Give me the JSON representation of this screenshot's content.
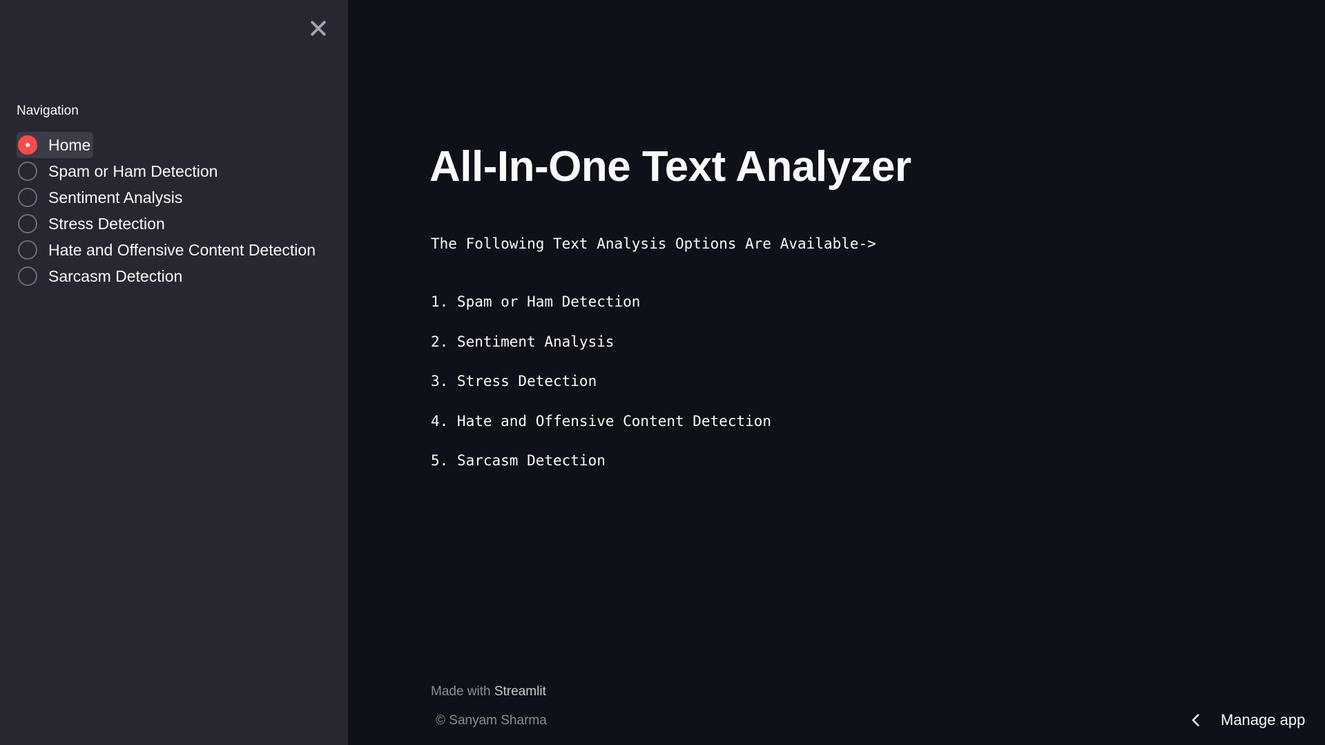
{
  "sidebar": {
    "close_icon": "close-icon",
    "nav_label": "Navigation",
    "items": [
      {
        "label": "Home",
        "selected": true
      },
      {
        "label": "Spam or Ham Detection",
        "selected": false
      },
      {
        "label": "Sentiment Analysis",
        "selected": false
      },
      {
        "label": "Stress Detection",
        "selected": false
      },
      {
        "label": "Hate and Offensive Content Detection",
        "selected": false
      },
      {
        "label": "Sarcasm Detection",
        "selected": false
      }
    ]
  },
  "main": {
    "title": "All-In-One Text Analyzer",
    "intro": "The Following Text Analysis Options Are Available->",
    "options": [
      "1. Spam or Ham Detection",
      "2. Sentiment Analysis",
      "3. Stress Detection",
      "4. Hate and Offensive Content Detection",
      "5. Sarcasm Detection"
    ]
  },
  "footer": {
    "made_with": "Made with",
    "brand": "Streamlit",
    "copyright": "© Sanyam Sharma"
  },
  "manage_app": {
    "label": "Manage app",
    "icon": "chevron-left-icon"
  },
  "colors": {
    "accent": "#ff4b4b",
    "sidebar_bg": "#262730",
    "main_bg": "#0e1117"
  }
}
